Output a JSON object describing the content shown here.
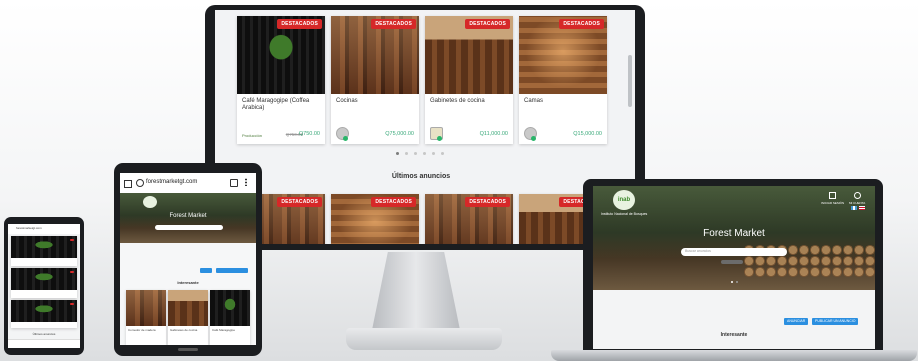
{
  "desktop": {
    "cards_top": [
      {
        "badge": "DESTACADOS",
        "title": "Café Maragogipe (Coffea Arabica)",
        "price": "Q750.00",
        "price_old": "Q750.00",
        "seller": "Producción"
      },
      {
        "badge": "DESTACADOS",
        "title": "Cocinas",
        "price": "Q75,000.00"
      },
      {
        "badge": "DESTACADOS",
        "title": "Gabinetes de cocina",
        "price": "Q11,000.00"
      },
      {
        "badge": "DESTACADOS",
        "title": "Camas",
        "price": "Q15,000.00"
      }
    ],
    "carousel_dots": 6,
    "section_title": "Últimos anuncios",
    "cards_bottom_badges": [
      "DESTACADOS",
      "DESTACADOS",
      "DESTACADOS",
      "DESTACADOS"
    ]
  },
  "laptop": {
    "hero_title": "Forest Market",
    "logo_text": "inab",
    "institute_text": "Instituto Nacional de Bosques",
    "search_placeholder": "Buscar anuncios",
    "button_primary": "ANUNCIAR",
    "button_secondary": "PUBLICAR UN ANUNCIO",
    "nav_right": [
      "INICIAR SESIÓN",
      "MI CUENTA"
    ],
    "section_label": "Interesante"
  },
  "tablet": {
    "url": "forestmarketgt.com",
    "hero_title": "Forest Market",
    "section_label": "Interesante",
    "cards": [
      {
        "title": "Comedor de madera"
      },
      {
        "title": "Gabinetes de cocina"
      },
      {
        "title": "Café Maragogipe"
      }
    ]
  },
  "phone": {
    "url": "forestmarketgt.com",
    "footer_label": "Últimos anuncios"
  },
  "colors": {
    "badge": "#d62828",
    "price": "#3aa97a",
    "accent": "#2b8fe0",
    "bezel": "#1b1d20"
  }
}
